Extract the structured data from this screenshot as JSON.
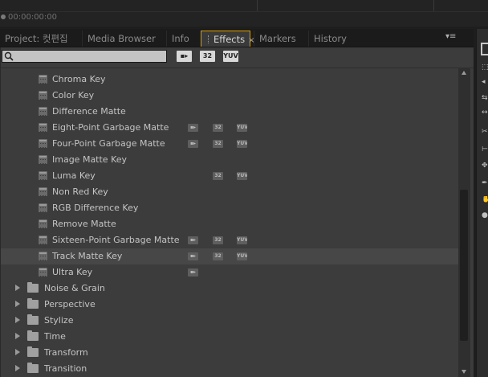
{
  "top": {
    "timecode": "00:00:00:00"
  },
  "tabs": [
    {
      "label": "Project: 컷편집"
    },
    {
      "label": "Media Browser"
    },
    {
      "label": "Info"
    },
    {
      "label": "Effects",
      "close": "×"
    },
    {
      "label": "Markers"
    },
    {
      "label": "History"
    }
  ],
  "panel_menu": "▾≡",
  "toolbar": {
    "search_value": "",
    "buttons": [
      {
        "icon": "accelerated-effects-icon",
        "label": "▪▸"
      },
      {
        "icon": "32bit-effects-icon",
        "label": "32"
      },
      {
        "icon": "yuv-effects-icon",
        "label": "YUV"
      }
    ]
  },
  "badges": {
    "acc": "▪▸",
    "b32": "32",
    "yuv": "YUV"
  },
  "effects": [
    {
      "label": "Chroma Key",
      "badges": []
    },
    {
      "label": "Color Key",
      "badges": []
    },
    {
      "label": "Difference Matte",
      "badges": []
    },
    {
      "label": "Eight-Point Garbage Matte",
      "badges": [
        "acc",
        "32",
        "yuv"
      ]
    },
    {
      "label": "Four-Point Garbage Matte",
      "badges": [
        "acc",
        "32",
        "yuv"
      ]
    },
    {
      "label": "Image Matte Key",
      "badges": []
    },
    {
      "label": "Luma Key",
      "badges": [
        "32",
        "yuv"
      ]
    },
    {
      "label": "Non Red Key",
      "badges": []
    },
    {
      "label": "RGB Difference Key",
      "badges": []
    },
    {
      "label": "Remove Matte",
      "badges": []
    },
    {
      "label": "Sixteen-Point Garbage Matte",
      "badges": [
        "acc",
        "32",
        "yuv"
      ]
    },
    {
      "label": "Track Matte Key",
      "badges": [
        "acc",
        "32",
        "yuv"
      ],
      "selected": true
    },
    {
      "label": "Ultra Key",
      "badges": [
        "acc"
      ]
    }
  ],
  "folders": [
    {
      "label": "Noise & Grain"
    },
    {
      "label": "Perspective"
    },
    {
      "label": "Stylize"
    },
    {
      "label": "Time"
    },
    {
      "label": "Transform"
    },
    {
      "label": "Transition"
    }
  ]
}
